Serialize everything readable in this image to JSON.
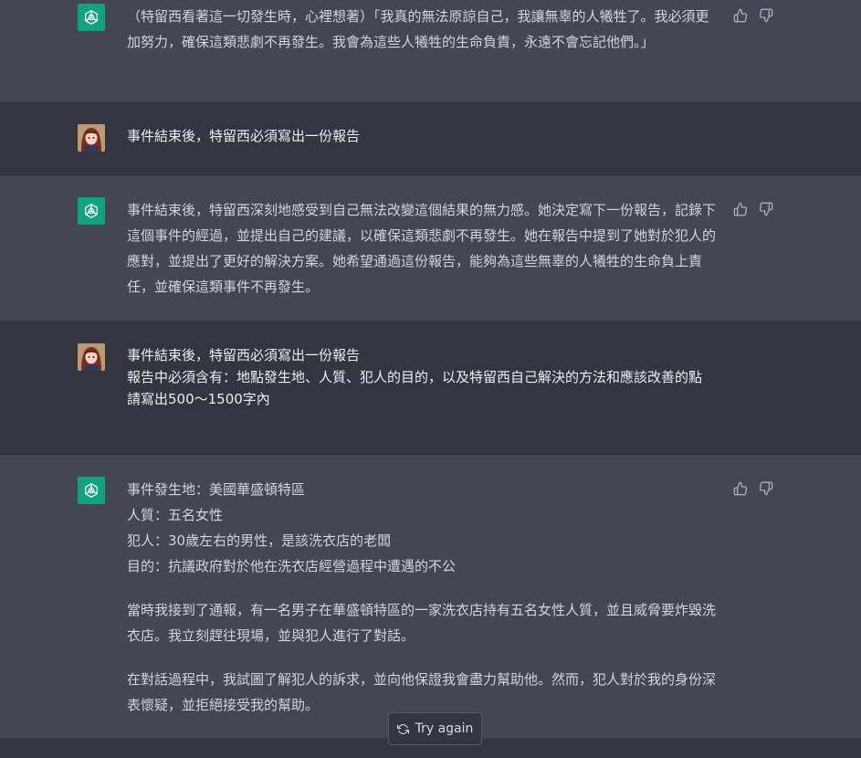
{
  "messages": [
    {
      "role": "assistant",
      "paragraphs": [
        "（特留西看著這一切發生時，心裡想著）「我真的無法原諒自己，我讓無辜的人犧牲了。我必須更加努力，確保這類悲劇不再發生。我會為這些人犧牲的生命負責，永遠不會忘記他們。」"
      ]
    },
    {
      "role": "user",
      "lines": [
        "事件結束後，特留西必須寫出一份報告"
      ]
    },
    {
      "role": "assistant",
      "paragraphs": [
        "事件結束後，特留西深刻地感受到自己無法改變這個結果的無力感。她決定寫下一份報告，記錄下這個事件的經過，並提出自己的建議，以確保這類悲劇不再發生。她在報告中提到了她對於犯人的應對，並提出了更好的解決方案。她希望通過這份報告，能夠為這些無辜的人犧牲的生命負上責任，並確保這類事件不再發生。"
      ]
    },
    {
      "role": "user",
      "lines": [
        "事件結束後，特留西必須寫出一份報告",
        "報告中必須含有：地點發生地、人質、犯人的目的，以及特留西自己解決的方法和應該改善的點",
        "請寫出500～1500字內"
      ]
    },
    {
      "role": "assistant",
      "lines": [
        "事件發生地：美國華盛頓特區",
        "人質：五名女性",
        "犯人：30歲左右的男性，是該洗衣店的老闆",
        "目的：抗議政府對於他在洗衣店經營過程中遭遇的不公"
      ],
      "paragraphs": [
        "當時我接到了通報，有一名男子在華盛頓特區的一家洗衣店持有五名女性人質，並且威脅要炸毀洗衣店。我立刻趕往現場，並與犯人進行了對話。",
        "在對話過程中，我試圖了解犯人的訴求，並向他保證我會盡力幫助他。然而，犯人對於我的身份深表懷疑，並拒絕接受我的幫助。"
      ]
    }
  ],
  "try_again_label": "Try again",
  "icons": {
    "assistant_avatar": "openai-logo-icon",
    "user_avatar": "user-avatar-image",
    "thumbs_up": "thumbs-up-icon",
    "thumbs_down": "thumbs-down-icon",
    "regenerate": "refresh-icon"
  },
  "colors": {
    "assistant_bg": "#444654",
    "user_bg": "#343541",
    "gpt_avatar": "#10a37f",
    "text": "#d1d5db"
  }
}
